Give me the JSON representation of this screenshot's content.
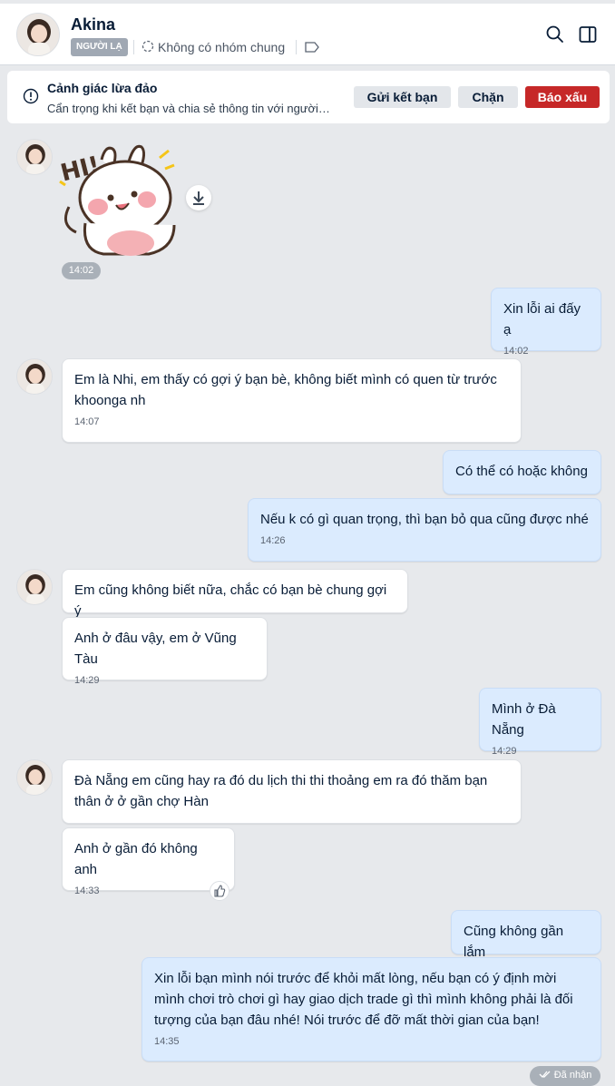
{
  "header": {
    "name": "Akina",
    "tag": "NGƯỜI LẠ",
    "groups": "Không có nhóm chung"
  },
  "alert": {
    "title": "Cảnh giác lừa đảo",
    "subtitle": "Cẩn trọng khi kết bạn và chia sẻ thông tin với người…",
    "add_friend": "Gửi kết bạn",
    "block": "Chặn",
    "report": "Báo xấu"
  },
  "sticker": {
    "text": "HI!",
    "time": "14:02"
  },
  "messages": [
    {
      "dir": "out",
      "text": "Xin lỗi ai đấy ạ",
      "time": "14:02"
    },
    {
      "dir": "in",
      "text": "Em là Nhi, em thấy có gợi ý bạn bè, không biết mình có quen từ trước khoonga nh",
      "time": "14:07"
    },
    {
      "dir": "out",
      "text": "Có thể có hoặc không",
      "time": ""
    },
    {
      "dir": "out",
      "text": "Nếu k có gì quan trọng, thì bạn bỏ qua cũng được nhé",
      "time": "14:26"
    },
    {
      "dir": "in",
      "text": "Em cũng không biết nữa, chắc có bạn bè chung gợi ý",
      "time": ""
    },
    {
      "dir": "in",
      "text": "Anh ở đâu vậy, em ở Vũng Tàu",
      "time": "14:29"
    },
    {
      "dir": "out",
      "text": "Mình ở Đà Nẵng",
      "time": "14:29"
    },
    {
      "dir": "in",
      "text": "Đà Nẵng em cũng hay ra đó du lịch thi thi thoảng em ra đó thăm  bạn thân ở ở gần chợ Hàn",
      "time": ""
    },
    {
      "dir": "in",
      "text": "Anh ở gần đó không anh",
      "time": "14:33"
    },
    {
      "dir": "out",
      "text": "Cũng không gần lắm",
      "time": ""
    },
    {
      "dir": "out",
      "text": "Xin lỗi bạn mình nói trước để khỏi mất lòng, nếu bạn có ý định mời mình chơi trò chơi gì hay giao dịch trade gì thì mình không phải là đối tượng của bạn đâu nhé! Nói trước để đỡ mất thời gian của bạn!",
      "time": "14:35"
    }
  ],
  "status": "Đã nhận",
  "colors": {
    "report": "#c62828",
    "outgoing": "#dbebfe",
    "incoming": "#ffffff",
    "background": "#e7e9ec"
  }
}
